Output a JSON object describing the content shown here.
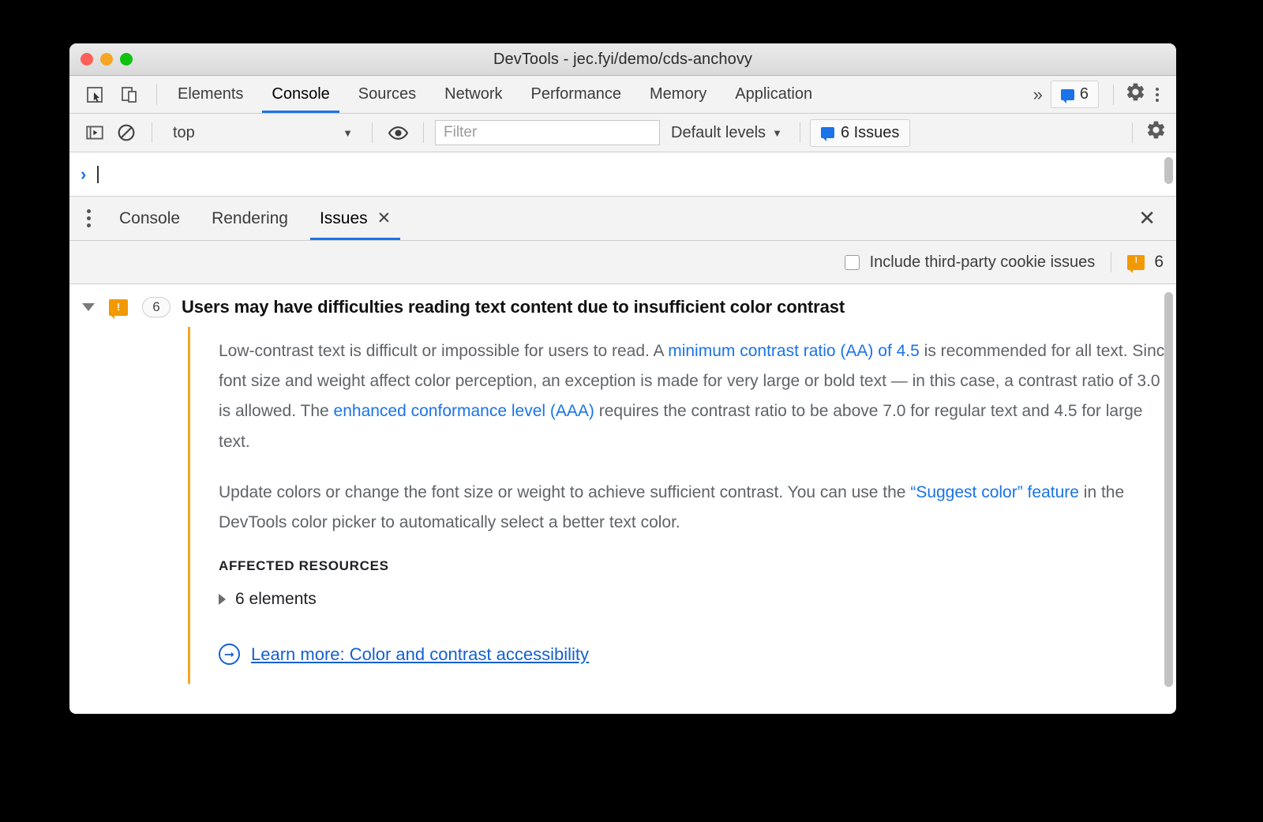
{
  "window": {
    "title": "DevTools - jec.fyi/demo/cds-anchovy",
    "traffic_lights": [
      "close",
      "minimize",
      "zoom"
    ]
  },
  "main_tabbar": {
    "icons": [
      "inspect-element-icon",
      "device-toolbar-icon"
    ],
    "tabs": [
      {
        "label": "Elements",
        "active": false
      },
      {
        "label": "Console",
        "active": true
      },
      {
        "label": "Sources",
        "active": false
      },
      {
        "label": "Network",
        "active": false
      },
      {
        "label": "Performance",
        "active": false
      },
      {
        "label": "Memory",
        "active": false
      },
      {
        "label": "Application",
        "active": false
      }
    ],
    "more_tabs": "»",
    "issues_badge_count": "6",
    "settings_icon": "gear-icon",
    "more_options_icon": "kebab-icon"
  },
  "console_toolbar": {
    "execute_icon": "console-sidebar-icon",
    "clear_icon": "clear-console-icon",
    "context": "top",
    "context_caret": "▼",
    "live_expression_icon": "eye-icon",
    "filter_placeholder": "Filter",
    "filter_value": "",
    "levels_label": "Default levels",
    "levels_caret": "▼",
    "issues_button_label": "6 Issues",
    "settings_icon": "gear-icon"
  },
  "console_prompt": {
    "chevron": "›",
    "value": ""
  },
  "drawer": {
    "menu_icon": "kebab-icon",
    "tabs": [
      {
        "label": "Console",
        "active": false,
        "closable": false
      },
      {
        "label": "Rendering",
        "active": false,
        "closable": false
      },
      {
        "label": "Issues",
        "active": true,
        "closable": true,
        "close_glyph": "✕"
      }
    ],
    "close_drawer_glyph": "✕"
  },
  "issues_toolbar": {
    "checkbox_label": "Include third-party cookie issues",
    "checkbox_checked": false,
    "warning_icon": "warning-bubble-icon",
    "warning_count": "6"
  },
  "issue": {
    "expanded": true,
    "severity_icon": "warning-bubble-icon",
    "count": "6",
    "title": "Users may have difficulties reading text content due to insufficient color contrast",
    "paragraph1": {
      "part1": "Low-contrast text is difficult or impossible for users to read. A ",
      "link1": "minimum contrast ratio (AA) of 4.5",
      "part2": " is recommended for all text. Since font size and weight affect color perception, an exception is made for very large or bold text — in this case, a contrast ratio of 3.0 is allowed. The ",
      "link2": "enhanced conformance level (AAA)",
      "part3": " requires the contrast ratio to be above 7.0 for regular text and 4.5 for large text."
    },
    "paragraph2": {
      "part1": "Update colors or change the font size or weight to achieve sufficient contrast. You can use the ",
      "link1": "“Suggest color” feature",
      "part2": " in the DevTools color picker to automatically select a better text color."
    },
    "affected_resources_heading": "AFFECTED RESOURCES",
    "affected_resources_item": "6 elements",
    "affected_resources_expanded": false,
    "learn_more_icon": "circled-arrow-icon",
    "learn_more_label": "Learn more: Color and contrast accessibility"
  },
  "colors": {
    "accent_blue": "#1a73e8",
    "link_blue": "#1560d0",
    "warning_orange": "#f29900",
    "issue_bar_orange": "#f5a623",
    "toolbar_grey": "#f3f3f3",
    "text_grey": "#5f6368"
  }
}
